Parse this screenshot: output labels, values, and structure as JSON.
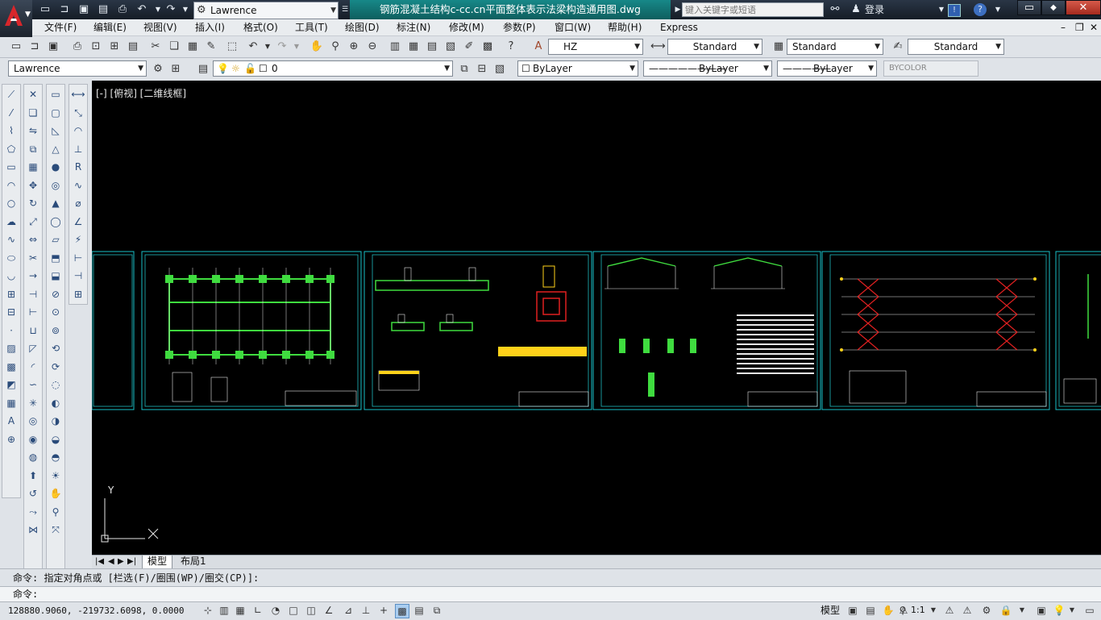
{
  "titlebar": {
    "workspace": "Lawrence",
    "title": "钢筋混凝土结构c-cc.cn平面整体表示法梁构造通用图.dwg",
    "search_placeholder": "键入关键字或短语",
    "login": "登录"
  },
  "menu": {
    "items": [
      "文件(F)",
      "编辑(E)",
      "视图(V)",
      "插入(I)",
      "格式(O)",
      "工具(T)",
      "绘图(D)",
      "标注(N)",
      "修改(M)",
      "参数(P)",
      "窗口(W)",
      "帮助(H)",
      "Express"
    ]
  },
  "toolbar1": {
    "text_style": "HZ",
    "dim_style": "Standard",
    "table_style": "Standard",
    "multileader_style": "Standard"
  },
  "toolbar2": {
    "workspace": "Lawrence",
    "layer": "0",
    "color": "ByLayer",
    "linetype": "ByLayer",
    "lineweight": "ByLayer",
    "plotstyle": "BYCOLOR"
  },
  "viewport": {
    "label": "[-] [俯视] [二维线框]"
  },
  "tabs": {
    "model": "模型",
    "layout1": "布局1"
  },
  "command": {
    "history": "命令: 指定对角点或 [栏选(F)/圈围(WP)/圈交(CP)]:",
    "prompt": "命令:"
  },
  "status": {
    "coordinates": "128880.9060, -219732.6098, 0.0000",
    "space": "模型",
    "annotation_scale": "1:1"
  },
  "ucs": {
    "y_label": "Y",
    "x_label": "X"
  },
  "colors": {
    "title_accent": "#178888",
    "drawing_bg": "#000000",
    "sheet_border": "#19c1c9",
    "grid_green": "#3fdc3f",
    "brace_red": "#e02020"
  }
}
